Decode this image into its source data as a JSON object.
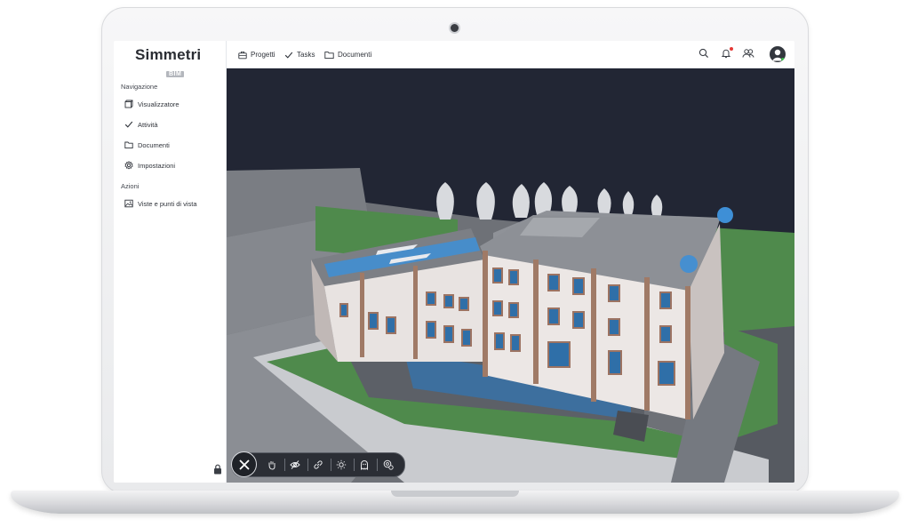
{
  "app": {
    "logo_text": "Simmetri",
    "logo_sub": "BIM"
  },
  "sidebar": {
    "sections": [
      {
        "title": "Navigazione",
        "items": [
          {
            "label": "Visualizzatore",
            "icon": "cube-icon"
          },
          {
            "label": "Attività",
            "icon": "check-icon"
          },
          {
            "label": "Documenti",
            "icon": "folder-icon"
          },
          {
            "label": "Impostazioni",
            "icon": "gear-icon"
          }
        ]
      },
      {
        "title": "Azioni",
        "items": [
          {
            "label": "Viste e punti di vista",
            "icon": "image-icon"
          }
        ]
      }
    ]
  },
  "topbar": {
    "links": [
      {
        "label": "Progetti",
        "icon": "briefcase-icon"
      },
      {
        "label": "Tasks",
        "icon": "check-icon"
      },
      {
        "label": "Documenti",
        "icon": "folder-icon"
      }
    ],
    "actions": [
      "search-icon",
      "bell-icon",
      "users-icon",
      "avatar"
    ]
  },
  "viewer": {
    "toolbar": [
      "close-icon",
      "hand-icon",
      "eye-off-icon",
      "link-icon",
      "sun-icon",
      "ghost-icon",
      "settings-icon"
    ]
  },
  "colors": {
    "viewport_bg": "#222634",
    "accent": "#3e8fd6",
    "notification": "#e53935"
  }
}
